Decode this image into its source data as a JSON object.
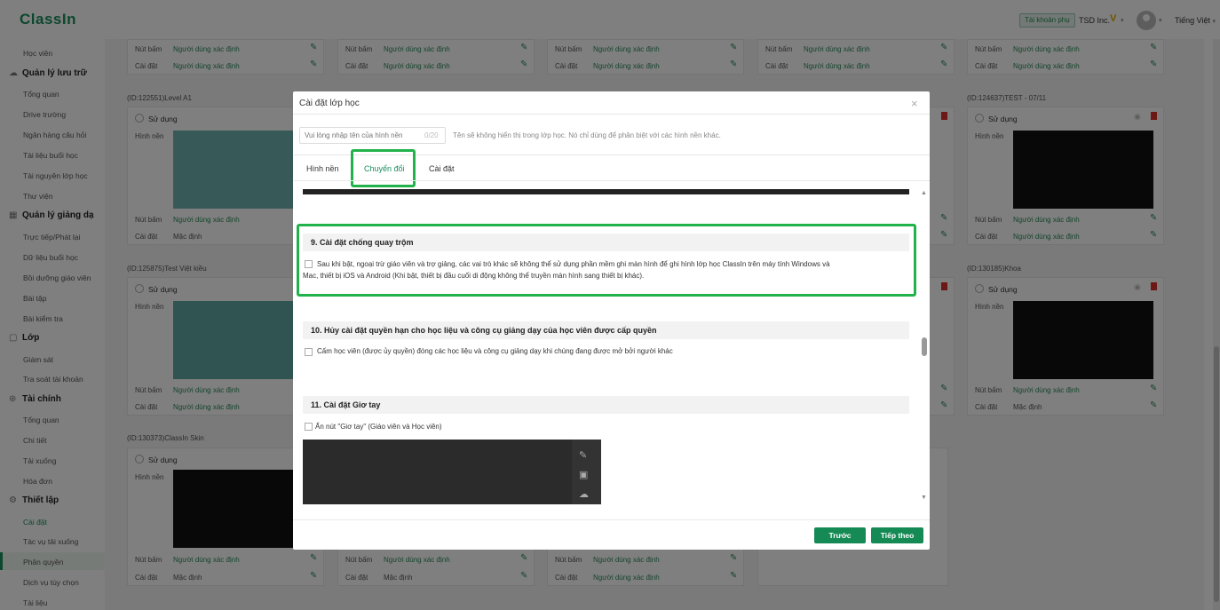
{
  "header": {
    "logo": "ClassIn",
    "account_badge": "Tài khoản phụ",
    "org_name": "TSD Inc.",
    "v_mark": "V",
    "language": "Tiếng Việt"
  },
  "sidebar": {
    "items": [
      {
        "label": "Học viên",
        "type": "item"
      },
      {
        "label": "Quản lý lưu trữ",
        "type": "head",
        "icon": "cloud-icon"
      },
      {
        "label": "Tổng quan",
        "type": "item"
      },
      {
        "label": "Drive trường",
        "type": "item"
      },
      {
        "label": "Ngân hàng câu hỏi",
        "type": "item"
      },
      {
        "label": "Tài liệu buổi học",
        "type": "item"
      },
      {
        "label": "Tài nguyên lớp học",
        "type": "item"
      },
      {
        "label": "Thư viện",
        "type": "item"
      },
      {
        "label": "Quản lý giảng dạ",
        "type": "head",
        "icon": "board-icon"
      },
      {
        "label": "Trực tiếp/Phát lại",
        "type": "item"
      },
      {
        "label": "Dữ liệu buổi học",
        "type": "item"
      },
      {
        "label": "Bồi dưỡng giáo viên",
        "type": "item"
      },
      {
        "label": "Bài tập",
        "type": "item"
      },
      {
        "label": "Bài kiểm tra",
        "type": "item"
      },
      {
        "label": "Lớp",
        "type": "head",
        "icon": "class-icon"
      },
      {
        "label": "Giám sát",
        "type": "item"
      },
      {
        "label": "Tra soát tài khoản",
        "type": "item"
      },
      {
        "label": "Tài chính",
        "type": "head",
        "icon": "finance-icon"
      },
      {
        "label": "Tổng quan",
        "type": "item"
      },
      {
        "label": "Chi tiết",
        "type": "item"
      },
      {
        "label": "Tải xuống",
        "type": "item"
      },
      {
        "label": "Hóa đơn",
        "type": "item"
      },
      {
        "label": "Thiết lập",
        "type": "head",
        "icon": "settings-icon"
      },
      {
        "label": "Cài đặt",
        "type": "item",
        "active": true
      },
      {
        "label": "Tác vụ tải xuống",
        "type": "item"
      },
      {
        "label": "Phân quyền",
        "type": "item"
      },
      {
        "label": "Dịch vụ tùy chọn",
        "type": "item"
      },
      {
        "label": "Tài liệu",
        "type": "item"
      }
    ]
  },
  "background": {
    "labels": {
      "button": "Nút bấm",
      "setting": "Cài đặt",
      "in_use": "Sử dụng",
      "wallpaper": "Hình nền",
      "user_defined": "Người dùng xác định",
      "default": "Mặc định"
    },
    "card_ids": {
      "r1c1": "(ID:122551)Level A1",
      "r1c5": "(ID:124637)TEST - 07/11",
      "r2c1": "(ID:125875)Test Việt kiều",
      "r2c5": "(ID:130185)Khoa",
      "r3c1": "(ID:130373)ClassIn Skin"
    }
  },
  "modal": {
    "title": "Cài đặt lớp học",
    "name_placeholder": "Vui lòng nhập tên của hình nền",
    "name_count": "0/20",
    "name_hint": "Tên sẽ không hiển thị trong lớp học. Nó chỉ dùng để phân biệt với các hình nền khác.",
    "tabs": [
      "Hình nền",
      "Chuyển đổi",
      "Cài đặt"
    ],
    "active_tab": "Chuyển đổi",
    "sections": {
      "s9": {
        "title": "9. Cài đặt chống quay trộm",
        "option_line1": "Sau khi bật, ngoại trừ giáo viên và trợ giảng, các vai trò khác sẽ không thể sử dụng phần mềm ghi màn hình để ghi hình lớp học ClassIn trên máy tính Windows và",
        "option_line2": "Mac, thiết bị iOS và Android (Khi bật, thiết bị đầu cuối di động không thể truyền màn hình sang thiết bị khác)."
      },
      "s10": {
        "title": "10. Hủy cài đặt quyền hạn cho học liệu và công cụ giảng dạy của học viên được cấp quyền",
        "option": "Cấm học viên (được ủy quyền) đóng các học liệu và công cụ giảng dạy khi chúng đang được mở bởi người khác"
      },
      "s11": {
        "title": "11. Cài đặt Giơ tay",
        "option": "Ẩn nút \"Giơ tay\" (Giáo viên và Học viên)"
      }
    },
    "buttons": {
      "prev": "Trước",
      "next": "Tiếp theo"
    }
  },
  "colors": {
    "brand": "#1a8f5c",
    "highlight": "#22b24c",
    "button": "#168a55",
    "delete": "#d9302b"
  }
}
